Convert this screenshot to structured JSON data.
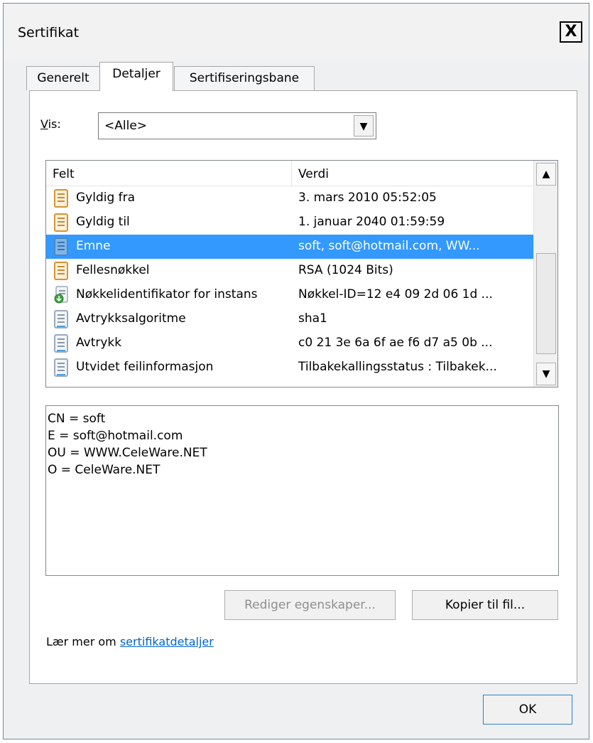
{
  "window": {
    "title": "Sertifikat",
    "close_label": "X"
  },
  "tabs": [
    {
      "label": "Generelt",
      "active": false
    },
    {
      "label": "Detaljer",
      "active": true
    },
    {
      "label": "Sertifiseringsbane",
      "active": false
    }
  ],
  "show": {
    "label": "Vis:",
    "value": "<Alle>"
  },
  "list": {
    "columns": [
      "Felt",
      "Verdi"
    ],
    "rows": [
      {
        "field": "Gyldig fra",
        "value": "3. mars 2010 05:52:05",
        "icon": "certificate-field-icon"
      },
      {
        "field": "Gyldig til",
        "value": "1. januar 2040 01:59:59",
        "icon": "certificate-field-icon"
      },
      {
        "field": "Emne",
        "value": "soft, soft@hotmail.com, WW...",
        "icon": "certificate-field-icon",
        "selected": true
      },
      {
        "field": "Fellesnøkkel",
        "value": "RSA (1024 Bits)",
        "icon": "certificate-field-icon"
      },
      {
        "field": "Nøkkelidentifikator for instans",
        "value": "Nøkkel-ID=12 e4 09 2d 06 1d ...",
        "icon": "extension-field-icon"
      },
      {
        "field": "Avtrykksalgoritme",
        "value": "sha1",
        "icon": "property-field-icon"
      },
      {
        "field": "Avtrykk",
        "value": "c0 21 3e 6a 6f ae f6 d7 a5 0b ...",
        "icon": "property-field-icon"
      },
      {
        "field": "Utvidet feilinformasjon",
        "value": "Tilbakekallingsstatus : Tilbakek...",
        "icon": "property-field-icon"
      }
    ]
  },
  "details": {
    "lines": [
      "CN = soft",
      "E = soft@hotmail.com",
      "OU = WWW.CeleWare.NET",
      "O = CeleWare.NET"
    ]
  },
  "buttons": {
    "edit_properties": "Rediger egenskaper...",
    "copy_to_file": "Kopier til fil...",
    "ok": "OK"
  },
  "learn": {
    "prefix": "Lær mer om ",
    "link": "sertifikatdetaljer"
  },
  "colors": {
    "selection": "#3399ff",
    "link": "#0066cc",
    "field_icon": "#e8a33c",
    "property_icon": "#9aaabb"
  }
}
